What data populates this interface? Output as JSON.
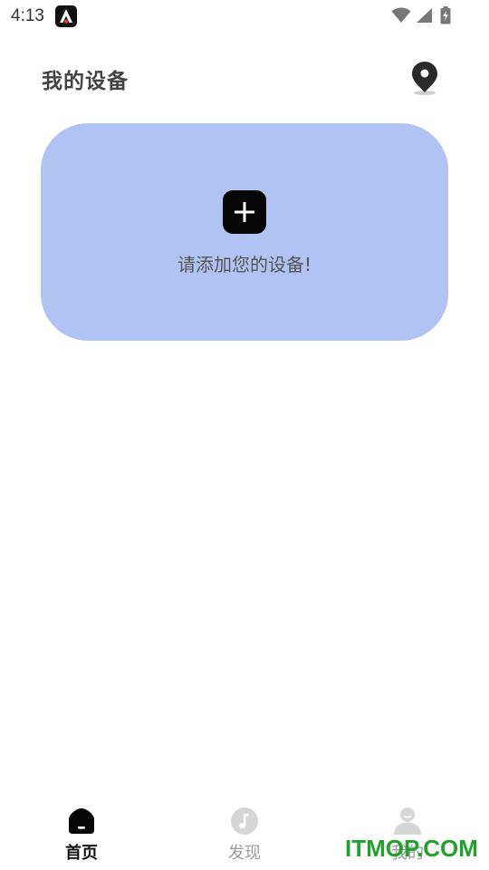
{
  "status_bar": {
    "time": "4:13"
  },
  "header": {
    "title": "我的设备",
    "location_icon": "location-pin-icon"
  },
  "device_card": {
    "prompt": "请添加您的设备!",
    "add_icon": "plus-icon",
    "background_color": "#b1c3f2"
  },
  "bottom_nav": {
    "items": [
      {
        "label": "首页",
        "icon": "home-icon",
        "active": true
      },
      {
        "label": "发现",
        "icon": "music-note-icon",
        "active": false
      },
      {
        "label": "我的",
        "icon": "user-icon",
        "active": false
      }
    ]
  },
  "watermark": {
    "text": "ITMOP.COM",
    "color": "#1fa22c"
  }
}
